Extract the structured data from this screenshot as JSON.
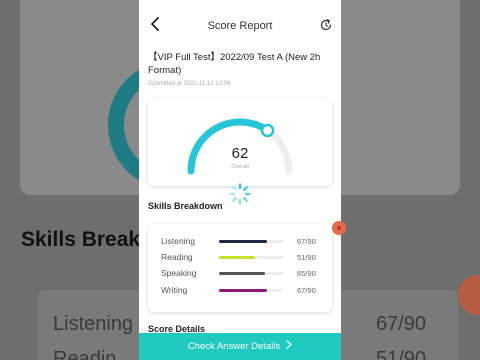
{
  "header": {
    "title": "Score Report",
    "back_icon": "chevron-left-icon",
    "refresh_icon": "refresh-icon"
  },
  "test": {
    "title": "【VIP Full Test】2022/09 Test A (New 2h Format)",
    "submitted": "Submitted at 2022-11-12 12:08"
  },
  "overall": {
    "score": "62",
    "label": "Overall",
    "progress": 0.69,
    "accent": "#26c6da"
  },
  "skills_section_title": "Skills Breakdown",
  "skills": [
    {
      "name": "Listening",
      "score": "67/90",
      "progress": 0.744,
      "color": "#1e2a44"
    },
    {
      "name": "Reading",
      "score": "51/90",
      "progress": 0.567,
      "color": "#c8e02a"
    },
    {
      "name": "Speaking",
      "score": "65/90",
      "progress": 0.722,
      "color": "#555555"
    },
    {
      "name": "Writing",
      "score": "67/90",
      "progress": 0.744,
      "color": "#8b1a7a"
    }
  ],
  "score_details_title": "Score Details",
  "cta": {
    "label": "Check Answer Details",
    "color": "#1fc9c0"
  },
  "background": {
    "heading": "Skills Breakd",
    "rows": [
      {
        "label": "Listening",
        "value": "67/90"
      },
      {
        "label": "Readin",
        "value": "51/90"
      }
    ]
  }
}
